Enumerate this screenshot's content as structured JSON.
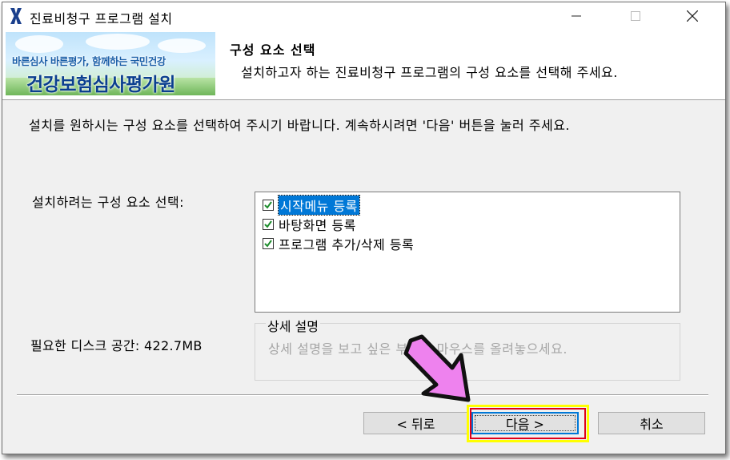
{
  "window": {
    "title": "진료비청구 프로그램 설치",
    "min_icon": "minimize-icon",
    "max_icon": "maximize-icon",
    "close_icon": "close-icon"
  },
  "header": {
    "banner_slogan": "바른심사 바른평가, 함께하는 국민건강",
    "banner_org": "건강보험심사평가원",
    "title": "구성 요소 선택",
    "subtitle": "설치하고자 하는 진료비청구 프로그램의 구성 요소를 선택해 주세요."
  },
  "main": {
    "description": "설치를 원하시는 구성 요소를 선택하여 주시기 바랍니다. 계속하시려면 '다음' 버튼을 눌러 주세요.",
    "select_label": "설치하려는 구성 요소 선택:",
    "components": [
      {
        "label": "시작메뉴 등록",
        "checked": true,
        "selected": true
      },
      {
        "label": "바탕화면 등록",
        "checked": true,
        "selected": false
      },
      {
        "label": "프로그램 추가/삭제 등록",
        "checked": true,
        "selected": false
      }
    ],
    "detail_title": "상세 설명",
    "detail_text": "상세 설명을 보고 싶은 부분에 마우스를 올려놓으세요.",
    "disk_space": "필요한 디스크 공간: 422.7MB"
  },
  "buttons": {
    "back": "< 뒤로",
    "next": "다음 >",
    "cancel": "취소"
  },
  "annotation": {
    "arrow_color": "#ee82ee",
    "highlight_colors": [
      "#ffff00",
      "#e0001b"
    ]
  }
}
